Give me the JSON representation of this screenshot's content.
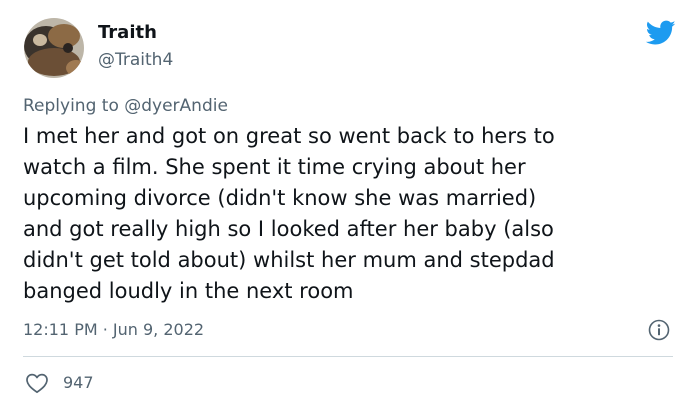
{
  "user": {
    "display_name": "Traith",
    "handle": "@Traith4"
  },
  "reply": {
    "prefix": "Replying to ",
    "mention": "@dyerAndie"
  },
  "tweet": {
    "lines": [
      "I met her and got on great so went back to hers to",
      "watch a film. She spent it time crying about her",
      "upcoming divorce (didn't know she was married)",
      "and got really high so I looked after her baby (also",
      "didn't get told about) whilst her mum and stepdad",
      "banged loudly in the next room"
    ],
    "timestamp": "12:11 PM · Jun 9, 2022"
  },
  "engagement": {
    "likes": "947"
  },
  "icons": {
    "brand": "twitter-bird-icon",
    "info": "info-icon",
    "like": "heart-icon"
  },
  "colors": {
    "brand": "#1d9bf0",
    "text": "#0f1419",
    "muted": "#536471",
    "divider": "#cfd9de"
  }
}
